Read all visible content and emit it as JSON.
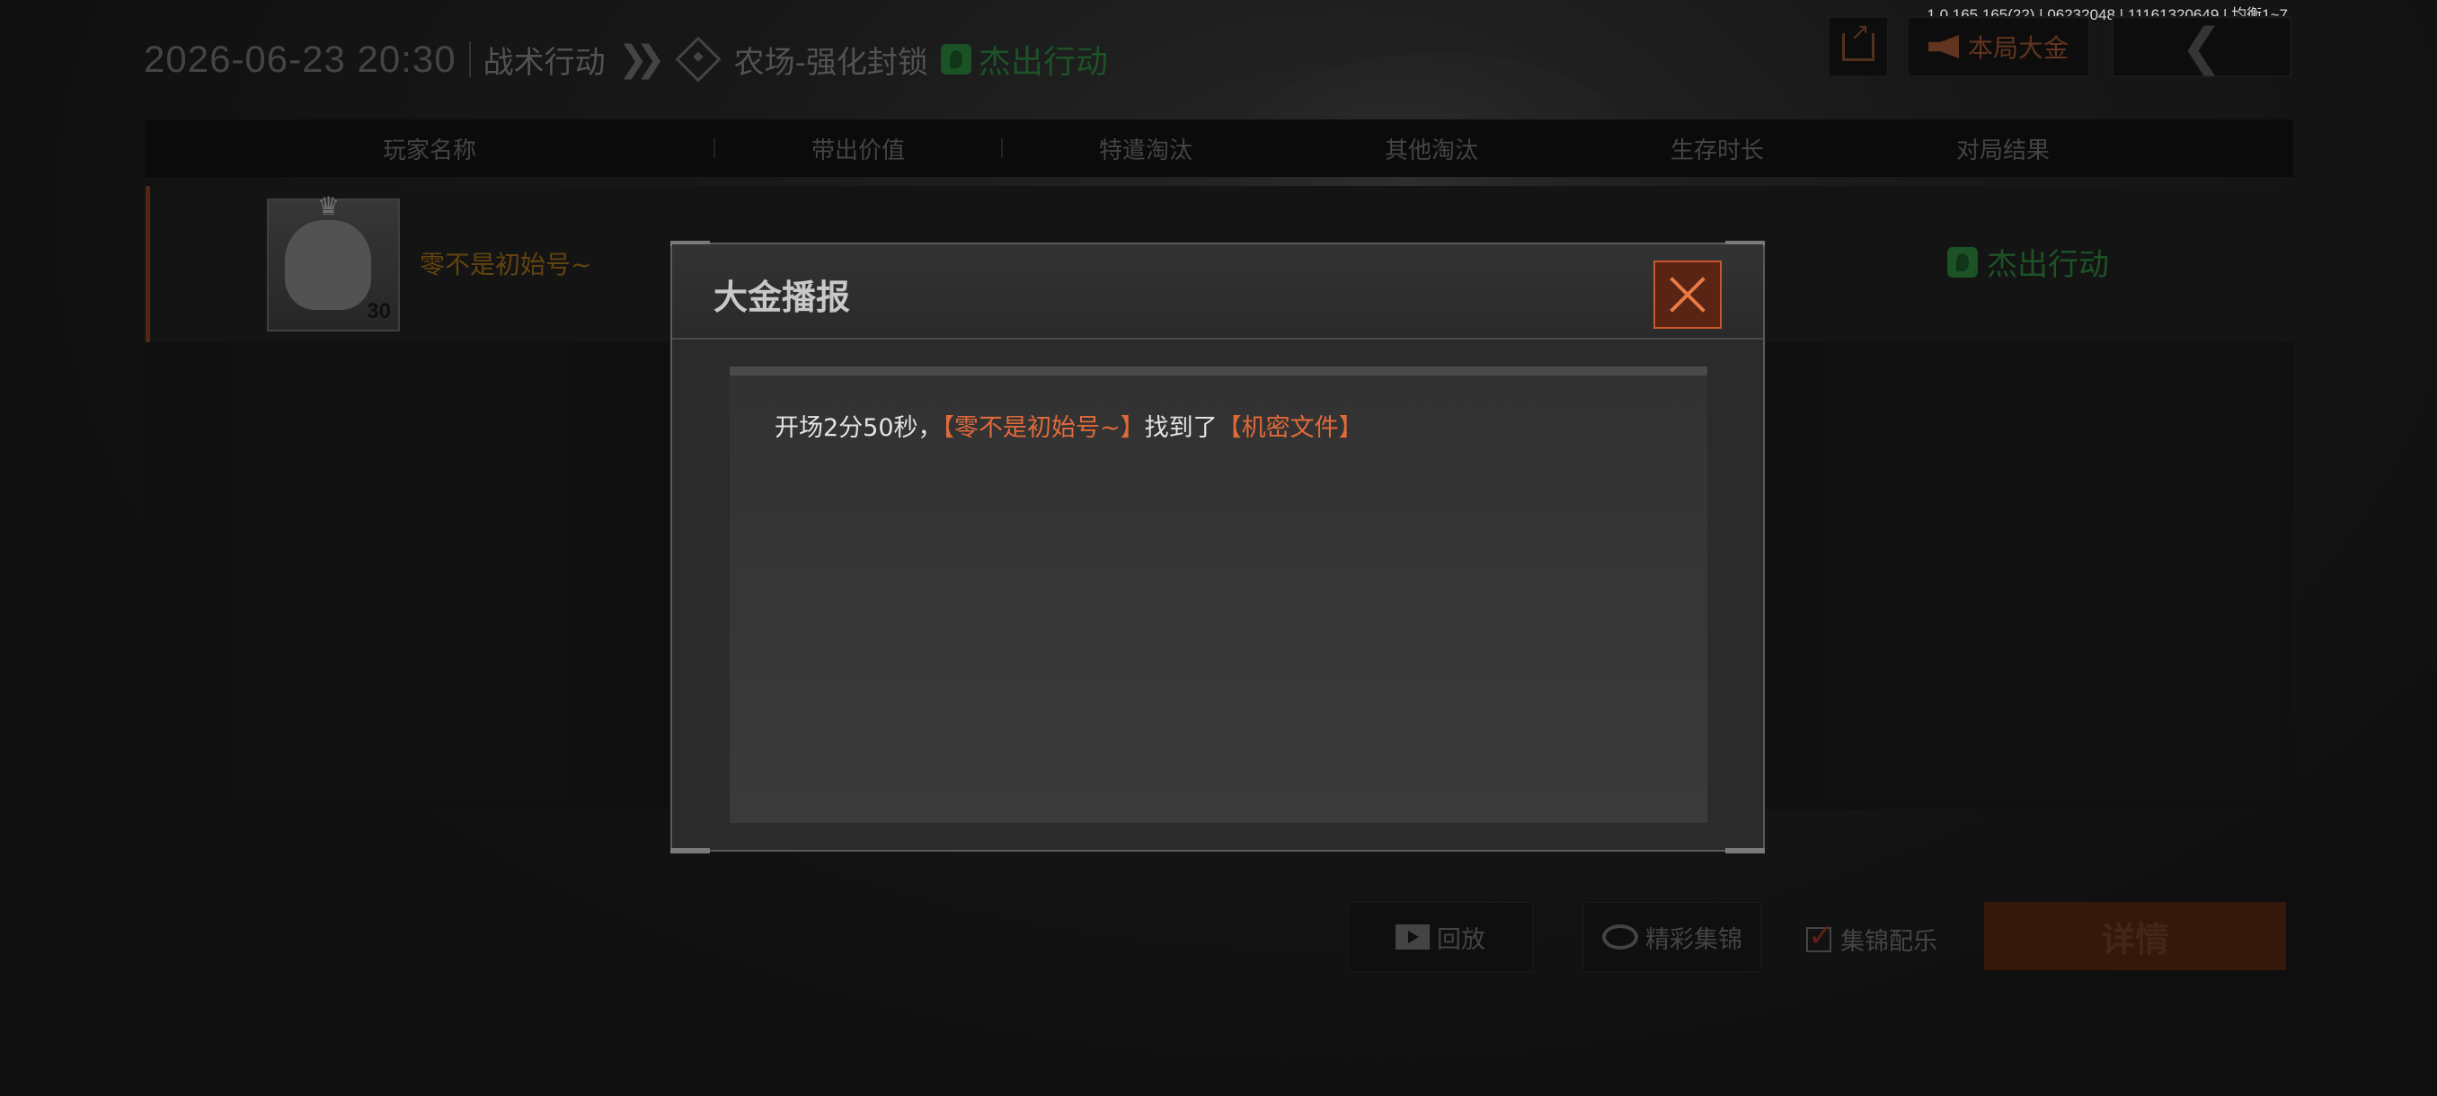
{
  "version": "1.0.165.165(22) | 06232048 | 11161320649 | 均衡1~7",
  "header": {
    "datetime": "2026-06-23 20:30",
    "mode": "战术行动",
    "map": "农场-强化封锁",
    "result": "杰出行动"
  },
  "top_buttons": {
    "share_icon": "share-icon",
    "bigcash_label": "本局大金",
    "back_icon": "chevron-left-icon"
  },
  "table": {
    "columns": [
      "玩家名称",
      "带出价值",
      "特遣淘汰",
      "其他淘汰",
      "生存时长",
      "对局结果"
    ],
    "rows": [
      {
        "player_name": "零不是初始号~",
        "level": "30",
        "result": "杰出行动"
      }
    ]
  },
  "bottom": {
    "replay_label": "回放",
    "highlight_label": "精彩集锦",
    "bgm_label": "集锦配乐",
    "bgm_checked": true,
    "details_label": "详情"
  },
  "dialog": {
    "title": "大金播报",
    "message": {
      "prefix": "开场2分50秒，",
      "player": "【零不是初始号~】",
      "middle": "找到了",
      "item": "【机密文件】"
    }
  },
  "colors": {
    "accent": "#e06a3a",
    "success": "#1f5a2a",
    "background": "#141414"
  }
}
